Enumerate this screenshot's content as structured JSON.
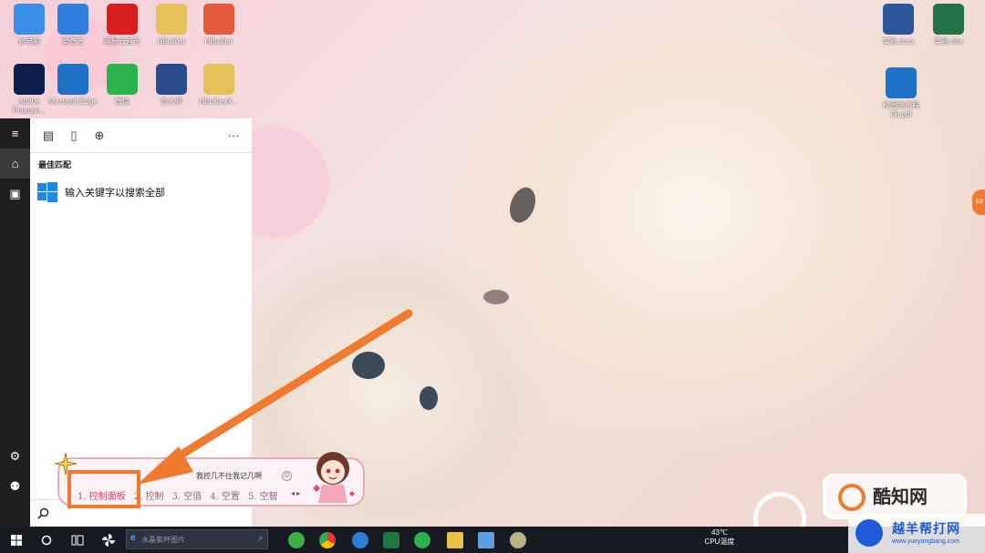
{
  "desktop": {
    "icons": [
      {
        "label": "此电脑",
        "icon": "computer-icon",
        "color": "#3a8ee6"
      },
      {
        "label": "爱奇艺",
        "icon": "video-player-icon",
        "color": "#2f7fe0"
      },
      {
        "label": "网易云音乐",
        "icon": "netease-music-icon",
        "color": "#d81e1e"
      },
      {
        "label": "HBuilder",
        "icon": "folder-icon",
        "color": "#e6c25a"
      },
      {
        "label": "HBuilder",
        "icon": "hbuilder-icon",
        "color": "#e55a3a"
      },
      {
        "label": "Adobe Photosh...",
        "icon": "photoshop-icon",
        "color": "#0a1f4d"
      },
      {
        "label": "Microsoft Edge",
        "icon": "edge-icon",
        "color": "#1e73c9"
      },
      {
        "label": "微信",
        "icon": "wechat-icon",
        "color": "#2bb24c"
      },
      {
        "label": "鲁大师",
        "icon": "ludashi-icon",
        "color": "#2b4c8a"
      },
      {
        "label": "HBuilderX...",
        "icon": "folder-icon",
        "color": "#e6c25a"
      },
      {
        "label": "实验.docx",
        "icon": "word-doc-icon",
        "color": "#2b579a"
      },
      {
        "label": "实验.xlsx",
        "icon": "excel-doc-icon",
        "color": "#217346"
      },
      {
        "label": "校园跑流程(9).pdf",
        "icon": "pdf-doc-icon",
        "color": "#1e73c9"
      }
    ]
  },
  "start_menu": {
    "rail": {
      "menu": "≡",
      "home": "⌂",
      "docs": "▣",
      "settings": "⚙",
      "user": "⚉"
    },
    "toolbar": {
      "apps_icon": "▤",
      "docs_icon": "▯",
      "web_icon": "⊕",
      "more": "···"
    },
    "best_match_title": "最佳匹配",
    "best_match_item": "输入关键字以搜索全部",
    "search_placeholder": ""
  },
  "ime": {
    "pinyin": "我控几不住我记几啊",
    "info_icon": "©",
    "candidates": [
      "1. 控制面板",
      "2. 控制",
      "3. 空值",
      "4. 空置",
      "5. 空智"
    ],
    "nav": "◂ ▸"
  },
  "taskbar": {
    "search_placeholder": "水晶紫杯图片",
    "tray_temp": "43℃",
    "tray_label": "CPU温度"
  },
  "watermarks": {
    "brand": "酷知网",
    "site_name": "越羊帮打网",
    "site_url": "www.yueyangbang.com",
    "side_tag": "83"
  },
  "colors": {
    "accent_orange": "#f07a2f",
    "taskbar": "#171a21",
    "rail": "#1f1f1f"
  }
}
